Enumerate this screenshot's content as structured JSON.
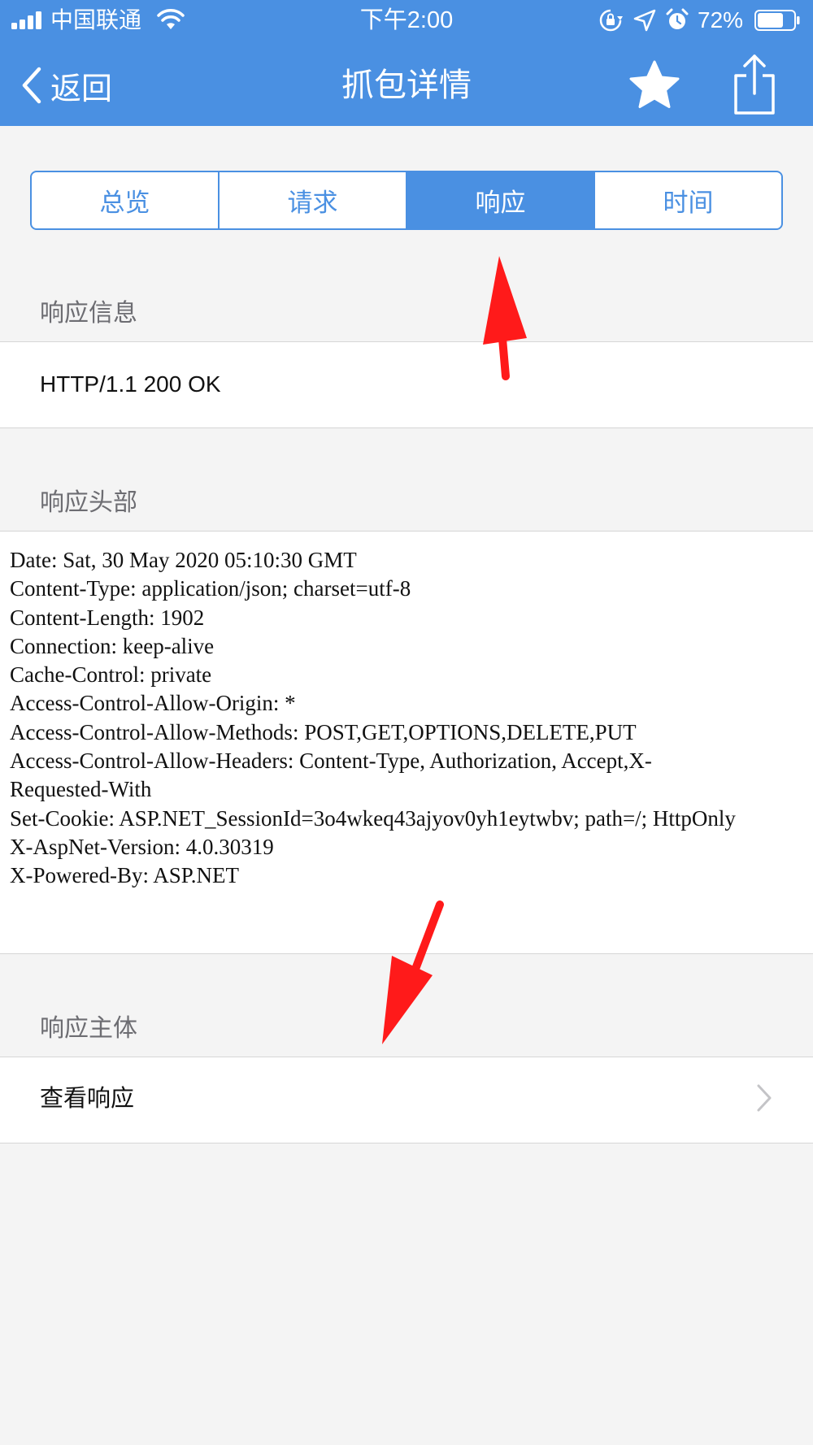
{
  "status_bar": {
    "carrier": "中国联通",
    "time": "下午2:00",
    "battery_percent": "72%",
    "battery_level": 0.72
  },
  "nav": {
    "back_label": "返回",
    "title": "抓包详情"
  },
  "tabs": [
    {
      "label": "总览",
      "active": false
    },
    {
      "label": "请求",
      "active": false
    },
    {
      "label": "响应",
      "active": true
    },
    {
      "label": "时间",
      "active": false
    }
  ],
  "sections": {
    "response_info": {
      "header": "响应信息",
      "status_line": "HTTP/1.1 200 OK"
    },
    "response_headers": {
      "header": "响应头部",
      "lines": [
        "Date: Sat, 30 May 2020 05:10:30 GMT",
        "Content-Type: application/json; charset=utf-8",
        "Content-Length: 1902",
        "Connection: keep-alive",
        "Cache-Control: private",
        "Access-Control-Allow-Origin: *",
        "Access-Control-Allow-Methods: POST,GET,OPTIONS,DELETE,PUT",
        "Access-Control-Allow-Headers: Content-Type, Authorization, Accept,X-Requested-With",
        "Set-Cookie: ASP.NET_SessionId=3o4wkeq43ajyov0yh1eytwbv; path=/; HttpOnly",
        "X-AspNet-Version: 4.0.30319",
        "X-Powered-By: ASP.NET"
      ]
    },
    "response_body": {
      "header": "响应主体",
      "view_label": "查看响应"
    }
  },
  "colors": {
    "accent": "#4a90e2",
    "annotation": "#ff1a1a",
    "background": "#f4f4f4"
  },
  "icons": [
    "signal-icon",
    "wifi-icon",
    "orientation-lock-icon",
    "location-icon",
    "alarm-icon",
    "battery-icon",
    "back-chevron-icon",
    "star-icon",
    "share-icon",
    "chevron-right-icon"
  ]
}
